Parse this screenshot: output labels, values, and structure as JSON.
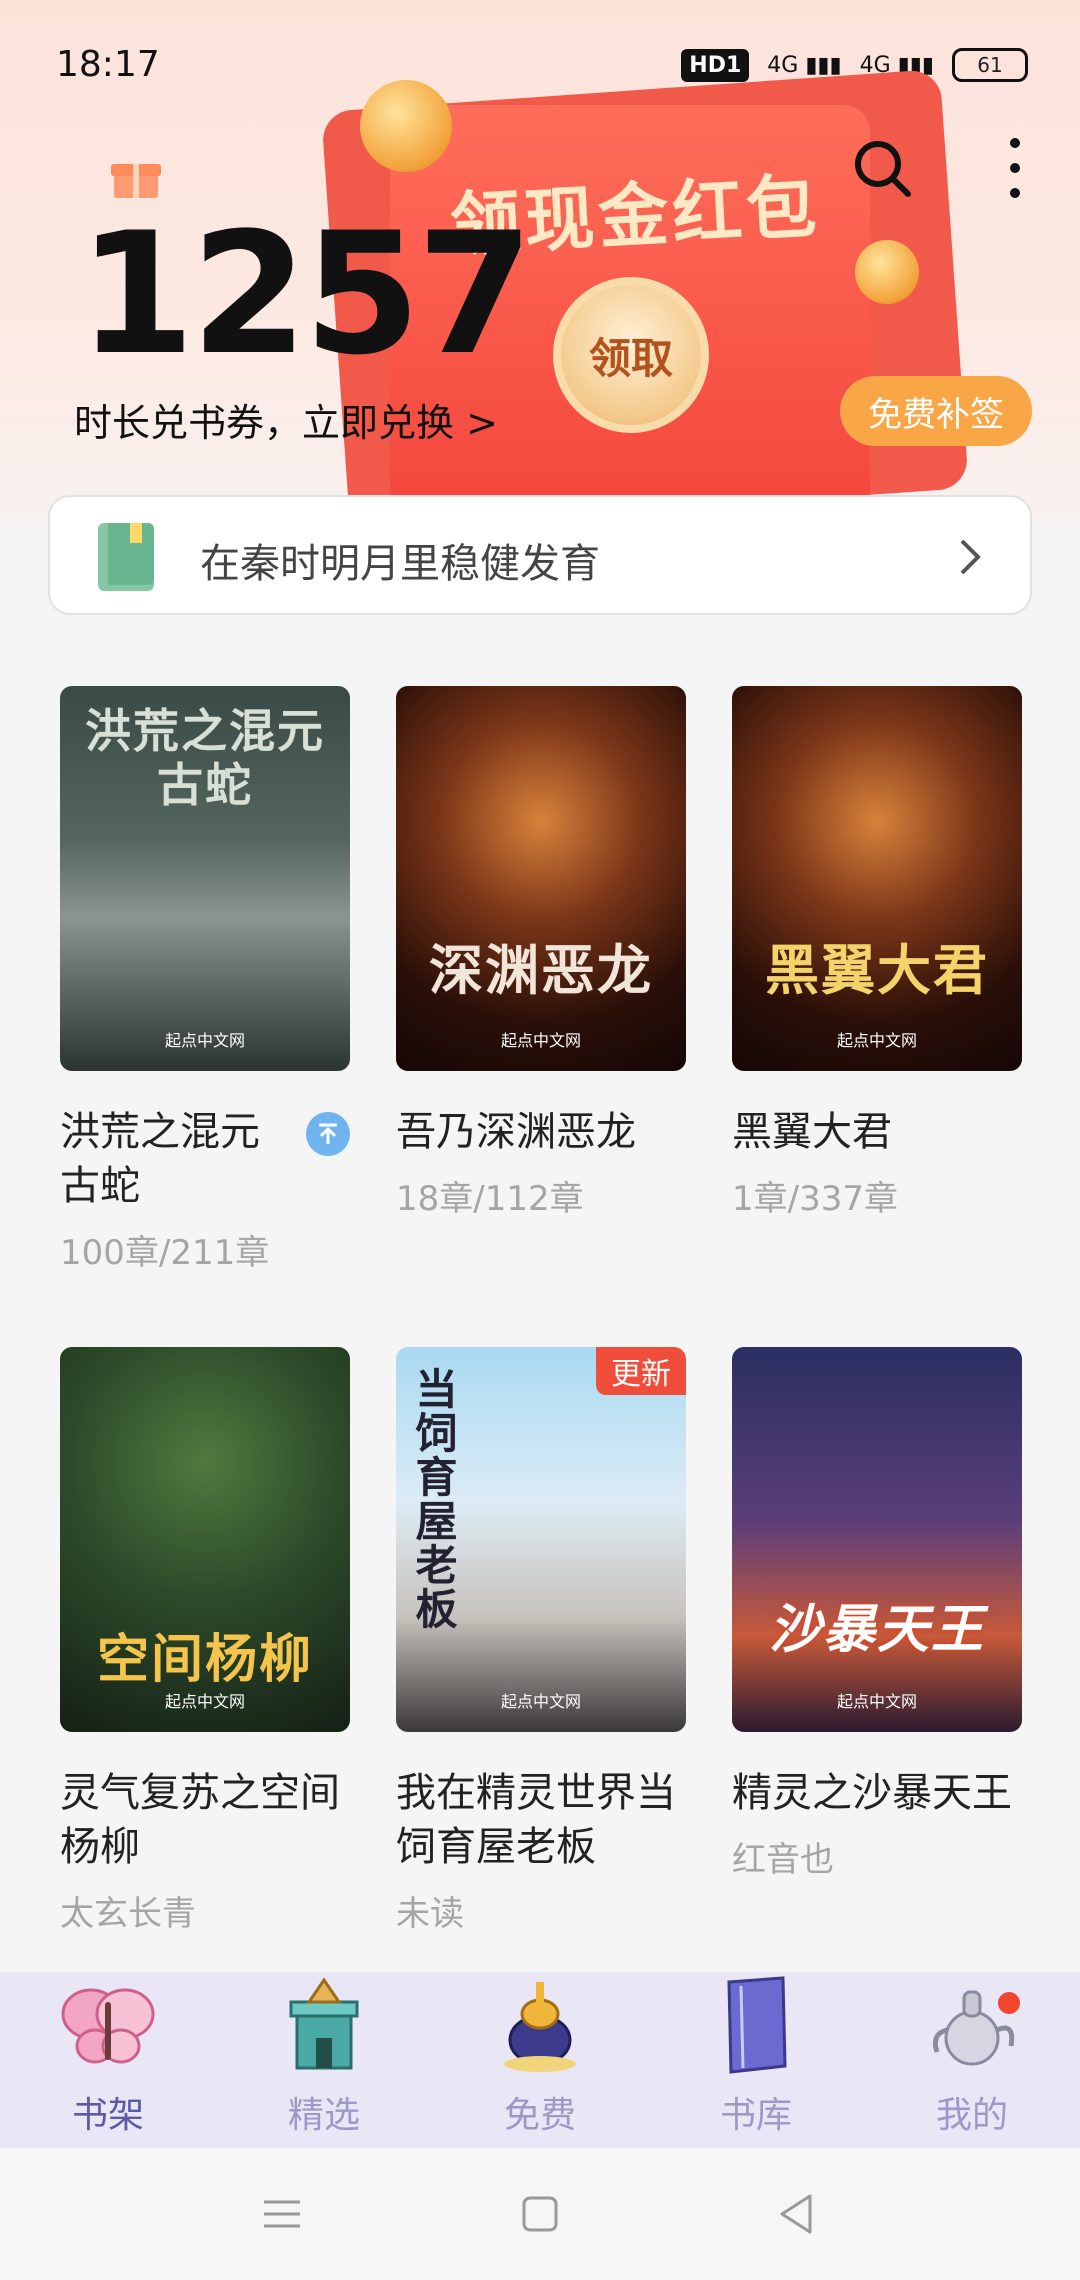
{
  "status_bar": {
    "time": "18:17",
    "hd_label": "HD1",
    "signal_1": "4G",
    "signal_2": "4G",
    "battery": "61"
  },
  "banner": {
    "envelope_title": "领现金红包",
    "claim_button": "领取",
    "minutes": "1257",
    "exchange_text": "时长兑书券，立即兑换 >",
    "makeup_button": "免费补签"
  },
  "recommend": {
    "text": "在秦时明月里稳健发育"
  },
  "books": [
    {
      "cover_title": "洪荒之混元古蛇",
      "title": "洪荒之混元古蛇",
      "progress": "100章/211章",
      "pinned": true
    },
    {
      "cover_title": "深渊恶龙",
      "title": "吾乃深渊恶龙",
      "progress": "18章/112章"
    },
    {
      "cover_title": "黑翼大君",
      "title": "黑翼大君",
      "progress": "1章/337章"
    },
    {
      "cover_title": "空间杨柳",
      "title": "灵气复苏之空间杨柳",
      "progress": "太玄长青"
    },
    {
      "cover_title": "当饲育屋老板",
      "title": "我在精灵世界当饲育屋老板",
      "progress": "未读",
      "badge": "更新"
    },
    {
      "cover_title": "沙暴天王",
      "title": "精灵之沙暴天王",
      "progress": "红音也"
    }
  ],
  "cover_publisher": "起点中文网",
  "nav": {
    "items": [
      {
        "label": "书架",
        "icon": "butterfly-icon"
      },
      {
        "label": "精选",
        "icon": "castle-icon"
      },
      {
        "label": "免费",
        "icon": "genie-lamp-icon"
      },
      {
        "label": "书库",
        "icon": "book-icon"
      },
      {
        "label": "我的",
        "icon": "teapot-icon"
      }
    ]
  }
}
